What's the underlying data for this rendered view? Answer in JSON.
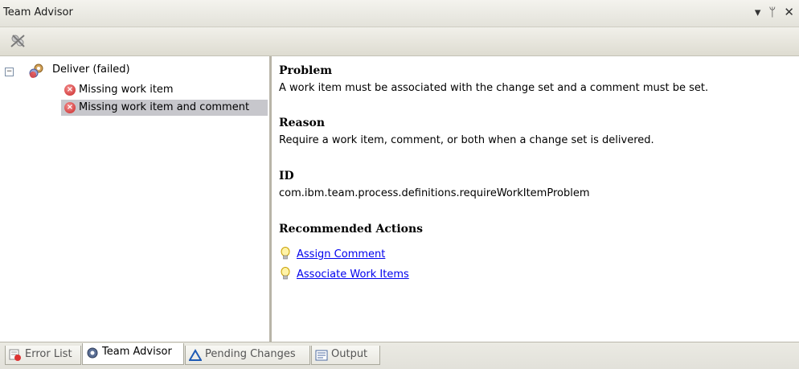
{
  "window": {
    "title": "Team Advisor",
    "controls": {
      "dropdown": "▾",
      "pin": "ᛘ",
      "close": "✕"
    }
  },
  "tree": {
    "root": {
      "label": "Deliver (failed)",
      "toggle": "−"
    },
    "children": [
      {
        "label": "Missing work item"
      },
      {
        "label": "Missing work item and comment",
        "selected": true
      }
    ]
  },
  "detail": {
    "problem_heading": "Problem",
    "problem_text": "A work item must be associated with the change set and a comment must be set.",
    "reason_heading": "Reason",
    "reason_text": "Require a work item, comment, or both when a change set is delivered.",
    "id_heading": "ID",
    "id_text": "com.ibm.team.process.definitions.requireWorkItemProblem",
    "actions_heading": "Recommended Actions",
    "actions": [
      {
        "label": "Assign Comment"
      },
      {
        "label": "Associate Work Items"
      }
    ]
  },
  "tabs": [
    {
      "label": "Error List",
      "icon": "error-list-icon"
    },
    {
      "label": "Team Advisor",
      "icon": "gear-icon",
      "active": true
    },
    {
      "label": "Pending Changes",
      "icon": "delta-icon"
    },
    {
      "label": "Output",
      "icon": "output-icon"
    }
  ]
}
